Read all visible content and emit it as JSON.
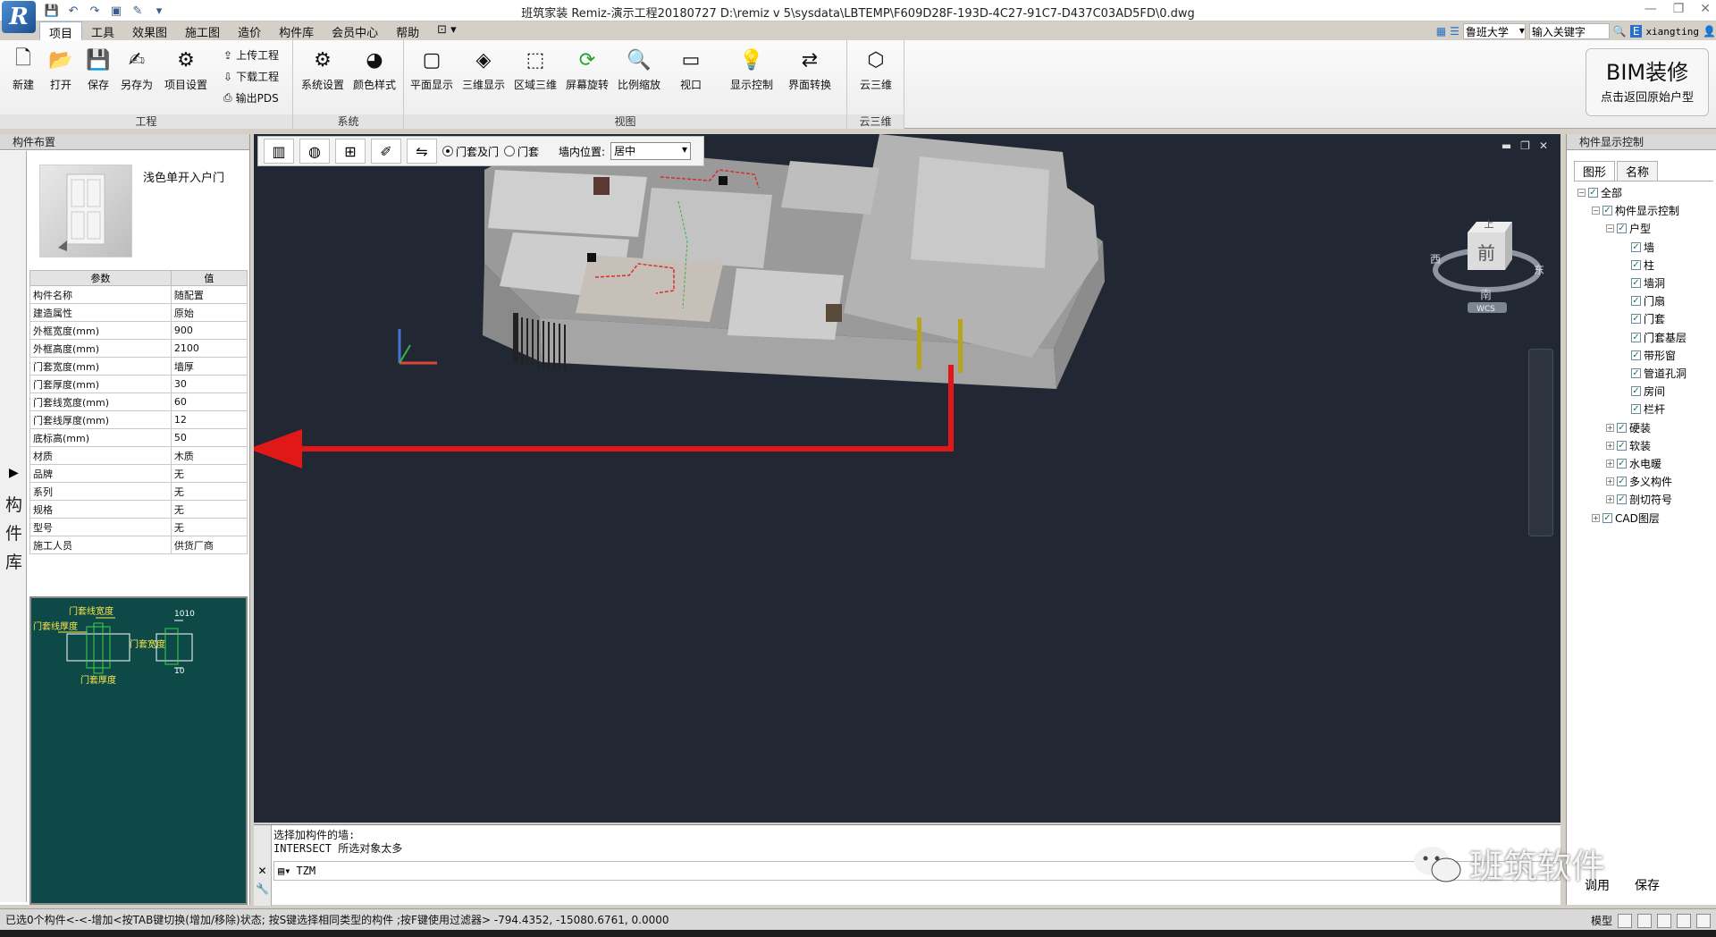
{
  "window": {
    "title": "班筑家装 Remiz-演示工程20180727      D:\\remiz v 5\\sysdata\\LBTEMP\\F609D28F-193D-4C27-91C7-D437C03AD5FD\\0.dwg",
    "logo_letter": "R"
  },
  "menu": [
    "项目",
    "工具",
    "效果图",
    "施工图",
    "造价",
    "构件库",
    "会员中心",
    "帮助"
  ],
  "top_right": {
    "university": "鲁班大学",
    "keyword_placeholder": "输入关键字",
    "user": "xiangting"
  },
  "ribbon": {
    "project_group": {
      "label": "工程",
      "buttons": [
        "新建",
        "打开",
        "保存",
        "另存为",
        "项目设置"
      ],
      "small": [
        "上传工程",
        "下载工程",
        "输出PDS"
      ]
    },
    "system_group": {
      "label": "系统",
      "buttons": [
        "系统设置",
        "颜色样式"
      ]
    },
    "view_group": {
      "label": "视图",
      "buttons": [
        "平面显示",
        "三维显示",
        "区域三维",
        "屏幕旋转",
        "比例缩放",
        "视口",
        "显示控制",
        "界面转换"
      ]
    },
    "cloud_group": {
      "label": "云三维",
      "buttons": [
        "云三维"
      ]
    },
    "bim": {
      "title": "BIM装修",
      "subtitle": "点击返回原始户型"
    }
  },
  "left_panel": {
    "title": "构件布置",
    "library_label": "构件库",
    "component_name": "浅色单开入户门",
    "table_headers": [
      "参数",
      "值"
    ],
    "rows": [
      [
        "构件名称",
        "随配置"
      ],
      [
        "建造属性",
        "原始"
      ],
      [
        "外框宽度(mm)",
        "900"
      ],
      [
        "外框高度(mm)",
        "2100"
      ],
      [
        "门套宽度(mm)",
        "墙厚"
      ],
      [
        "门套厚度(mm)",
        "30"
      ],
      [
        "门套线宽度(mm)",
        "60"
      ],
      [
        "门套线厚度(mm)",
        "12"
      ],
      [
        "底标高(mm)",
        "50"
      ],
      [
        "材质",
        "木质"
      ],
      [
        "品牌",
        "无"
      ],
      [
        "系列",
        "无"
      ],
      [
        "规格",
        "无"
      ],
      [
        "型号",
        "无"
      ],
      [
        "施工人员",
        "供货厂商"
      ]
    ],
    "diagram_labels": [
      "门套线宽度",
      "门套线厚度",
      "门套宽度",
      "门套厚度",
      "1010",
      "10"
    ]
  },
  "viewport_toolbar": {
    "radio_1": "门套及门",
    "radio_2": "门套",
    "wall_pos_label": "墙内位置:",
    "wall_pos_value": "居中",
    "selected_radio": "门套及门"
  },
  "viewcube": {
    "top": "上",
    "front": "前",
    "west": "西",
    "east": "东",
    "south": "南",
    "wcs": "WCS"
  },
  "command": {
    "line1": "选择加构件的墙:",
    "line2": "INTERSECT 所选对象太多",
    "input": "TZM"
  },
  "right_panel": {
    "title": "构件显示控制",
    "tabs": [
      "图形",
      "名称"
    ],
    "tree": [
      {
        "label": "全部",
        "level": 0,
        "expander": "−"
      },
      {
        "label": "构件显示控制",
        "level": 1,
        "expander": "−"
      },
      {
        "label": "户型",
        "level": 2,
        "expander": "−"
      },
      {
        "label": "墙",
        "level": 3,
        "expander": ""
      },
      {
        "label": "柱",
        "level": 3,
        "expander": ""
      },
      {
        "label": "墙洞",
        "level": 3,
        "expander": ""
      },
      {
        "label": "门扇",
        "level": 3,
        "expander": ""
      },
      {
        "label": "门套",
        "level": 3,
        "expander": ""
      },
      {
        "label": "门套基层",
        "level": 3,
        "expander": ""
      },
      {
        "label": "带形窗",
        "level": 3,
        "expander": ""
      },
      {
        "label": "管道孔洞",
        "level": 3,
        "expander": ""
      },
      {
        "label": "房间",
        "level": 3,
        "expander": ""
      },
      {
        "label": "栏杆",
        "level": 3,
        "expander": ""
      },
      {
        "label": "硬装",
        "level": 2,
        "expander": "+"
      },
      {
        "label": "软装",
        "level": 2,
        "expander": "+"
      },
      {
        "label": "水电暖",
        "level": 2,
        "expander": "+"
      },
      {
        "label": "多义构件",
        "level": 2,
        "expander": "+"
      },
      {
        "label": "剖切符号",
        "level": 2,
        "expander": "+"
      },
      {
        "label": "CAD图层",
        "level": 1,
        "expander": "+"
      }
    ],
    "buttons": [
      "调用",
      "保存"
    ]
  },
  "watermark": "班筑软件",
  "status": {
    "text": "已选0个构件<-<-增加<按TAB键切换(增加/移除)状态; 按S键选择相同类型的构件 ;按F键使用过滤器>  -794.4352,  -15080.6761, 0.0000",
    "model": "模型"
  }
}
